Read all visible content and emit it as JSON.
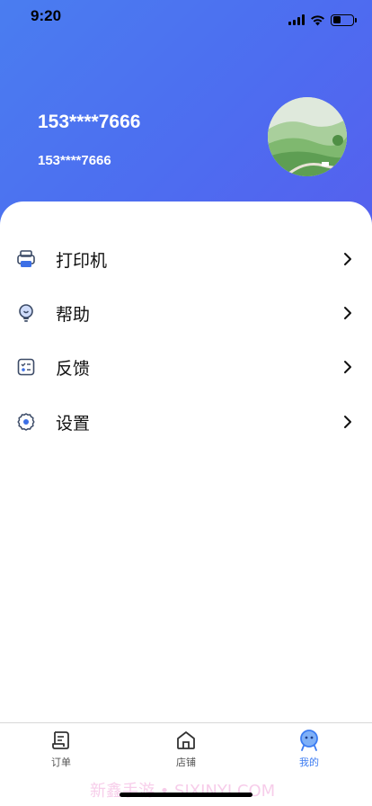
{
  "status_bar": {
    "time": "9:20"
  },
  "profile": {
    "name": "153****7666",
    "phone": "153****7666"
  },
  "menu": [
    {
      "label": "打印机",
      "icon": "printer-icon"
    },
    {
      "label": "帮助",
      "icon": "help-bulb-icon"
    },
    {
      "label": "反馈",
      "icon": "feedback-checklist-icon"
    },
    {
      "label": "设置",
      "icon": "gear-icon"
    }
  ],
  "tabs": [
    {
      "label": "订单",
      "icon": "order-icon",
      "active": false
    },
    {
      "label": "店铺",
      "icon": "store-icon",
      "active": false
    },
    {
      "label": "我的",
      "icon": "profile-icon",
      "active": true
    }
  ],
  "watermark": "新鑫手游 • SIXINYI.COM",
  "colors": {
    "header_gradient_start": "#4a7df0",
    "header_gradient_end": "#5560ee",
    "accent": "#3c7cf2"
  }
}
